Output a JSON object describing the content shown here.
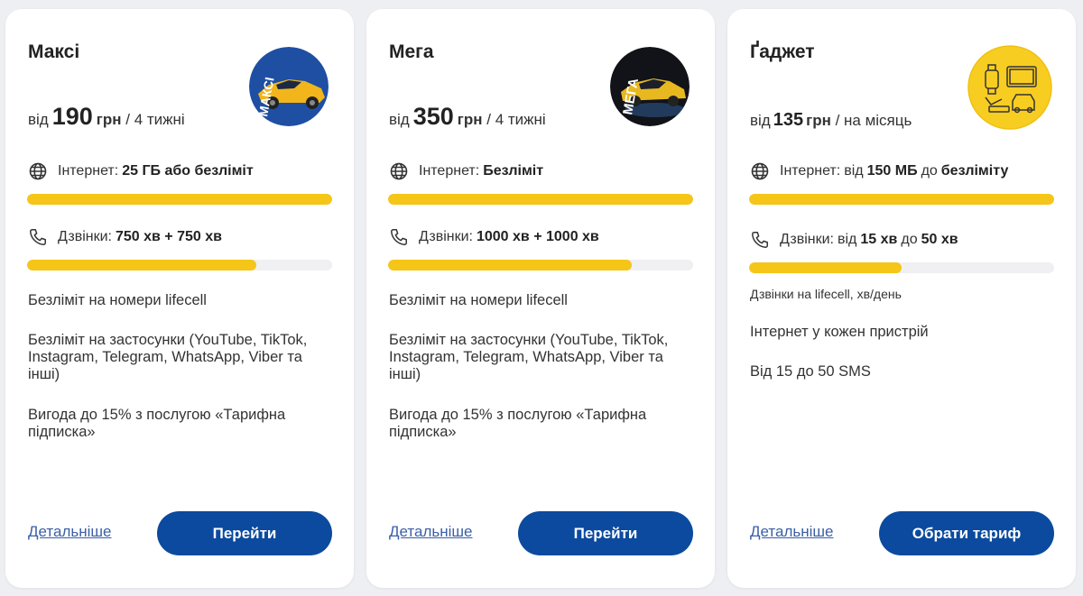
{
  "colors": {
    "accent": "#f5c518",
    "brand": "#0b4a9e",
    "link": "#3b5fa8"
  },
  "cards": [
    {
      "title": "Максі",
      "avatar_text": "МАКСІ",
      "price_pre": "від",
      "price_amount": "190",
      "price_currency": "грн",
      "price_period": "/ 4 тижні",
      "internet_label": "Інтернет:",
      "internet_value": "25 ГБ або безліміт",
      "internet_level": 1.0,
      "calls_label": "Дзвінки:",
      "calls_value": "750 хв + 750 хв",
      "calls_level": 0.75,
      "notes": [
        "Безліміт на номери lifecell",
        "Безліміт на застосунки (YouTube, TikTok, Instagram, Telegram, WhatsApp, Viber та інші)",
        "Вигода до 15% з послугою «Тарифна підписка»"
      ],
      "more_label": "Детальніше",
      "button_label": "Перейти"
    },
    {
      "title": "Мега",
      "avatar_text": "МЕГА",
      "price_pre": "від",
      "price_amount": "350",
      "price_currency": "грн",
      "price_period": "/ 4 тижні",
      "internet_label": "Інтернет:",
      "internet_value": "Безліміт",
      "internet_level": 1.0,
      "calls_label": "Дзвінки:",
      "calls_value": "1000 хв + 1000 хв",
      "calls_level": 0.8,
      "notes": [
        "Безліміт на номери lifecell",
        "Безліміт на застосунки (YouTube, TikTok, Instagram, Telegram, WhatsApp, Viber та інші)",
        "Вигода до 15% з послугою «Тарифна підписка»"
      ],
      "more_label": "Детальніше",
      "button_label": "Перейти"
    },
    {
      "title": "Ґаджет",
      "price_pre": "від",
      "price_amount": "135",
      "price_currency": "грн",
      "price_period": "/ на місяць",
      "internet_label": "Інтернет:",
      "internet_from": "від",
      "internet_min": "150 МБ",
      "internet_to": "до",
      "internet_max": "безліміту",
      "internet_level": 1.0,
      "calls_label": "Дзвінки:",
      "calls_from": "від",
      "calls_min": "15 хв",
      "calls_to": "до",
      "calls_max": "50 хв",
      "calls_level": 0.5,
      "calls_caption": "Дзвінки на lifecell, хв/день",
      "notes": [
        "Інтернет у кожен пристрій",
        "Від 15 до 50 SMS"
      ],
      "more_label": "Детальніше",
      "button_label": "Обрати тариф"
    }
  ]
}
